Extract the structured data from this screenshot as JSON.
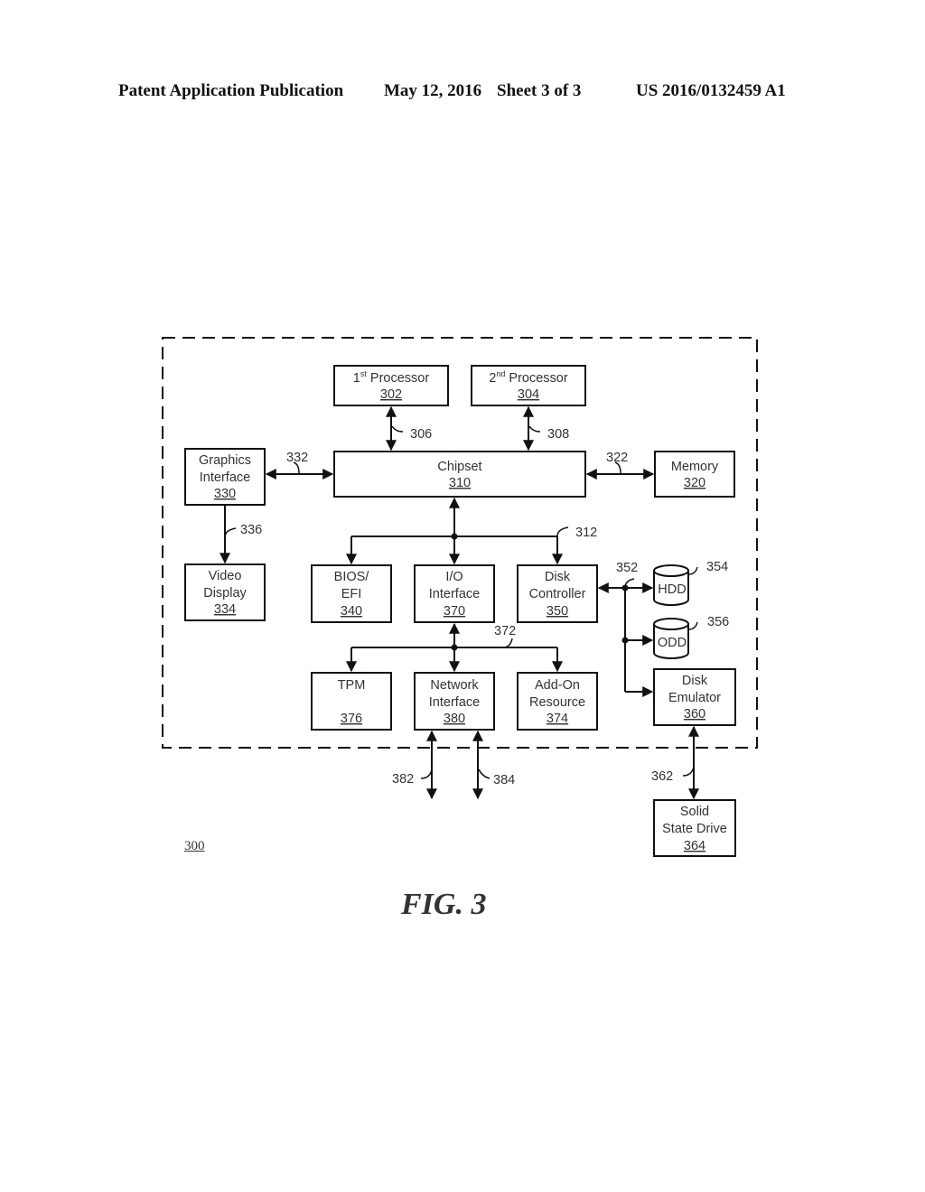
{
  "header": {
    "publication": "Patent Application Publication",
    "date": "May 12, 2016",
    "sheet": "Sheet 3 of 3",
    "number": "US 2016/0132459 A1"
  },
  "figure": {
    "label": "FIG. 3",
    "system_ref": "300"
  },
  "blocks": {
    "processor1": {
      "line1": "1",
      "sup": "st",
      "line1b": " Processor",
      "ref": "302"
    },
    "processor2": {
      "line1": "2",
      "sup": "nd",
      "line1b": " Processor",
      "ref": "304"
    },
    "graphics": {
      "line1": "Graphics",
      "line2": "Interface",
      "ref": "330"
    },
    "chipset": {
      "line1": "Chipset",
      "ref": "310"
    },
    "memory": {
      "line1": "Memory",
      "ref": "320"
    },
    "video": {
      "line1": "Video",
      "line2": "Display",
      "ref": "334"
    },
    "bios": {
      "line1": "BIOS/",
      "line2": "EFI",
      "ref": "340"
    },
    "io": {
      "line1": "I/O",
      "line2": "Interface",
      "ref": "370"
    },
    "disk_controller": {
      "line1": "Disk",
      "line2": "Controller",
      "ref": "350"
    },
    "hdd": {
      "label": "HDD",
      "ref": "354"
    },
    "odd": {
      "label": "ODD",
      "ref": "356"
    },
    "disk_emulator": {
      "line1": "Disk",
      "line2": "Emulator",
      "ref": "360"
    },
    "tpm": {
      "line1": "TPM",
      "ref": "376"
    },
    "network": {
      "line1": "Network",
      "line2": "Interface",
      "ref": "380"
    },
    "addon": {
      "line1": "Add-On",
      "line2": "Resource",
      "ref": "374"
    },
    "ssd": {
      "line1": "Solid",
      "line2": "State Drive",
      "ref": "364"
    }
  },
  "connections": {
    "c306": "306",
    "c308": "308",
    "c332": "332",
    "c322": "322",
    "c336": "336",
    "c312": "312",
    "c352": "352",
    "c372": "372",
    "c382": "382",
    "c384": "384",
    "c362": "362"
  }
}
